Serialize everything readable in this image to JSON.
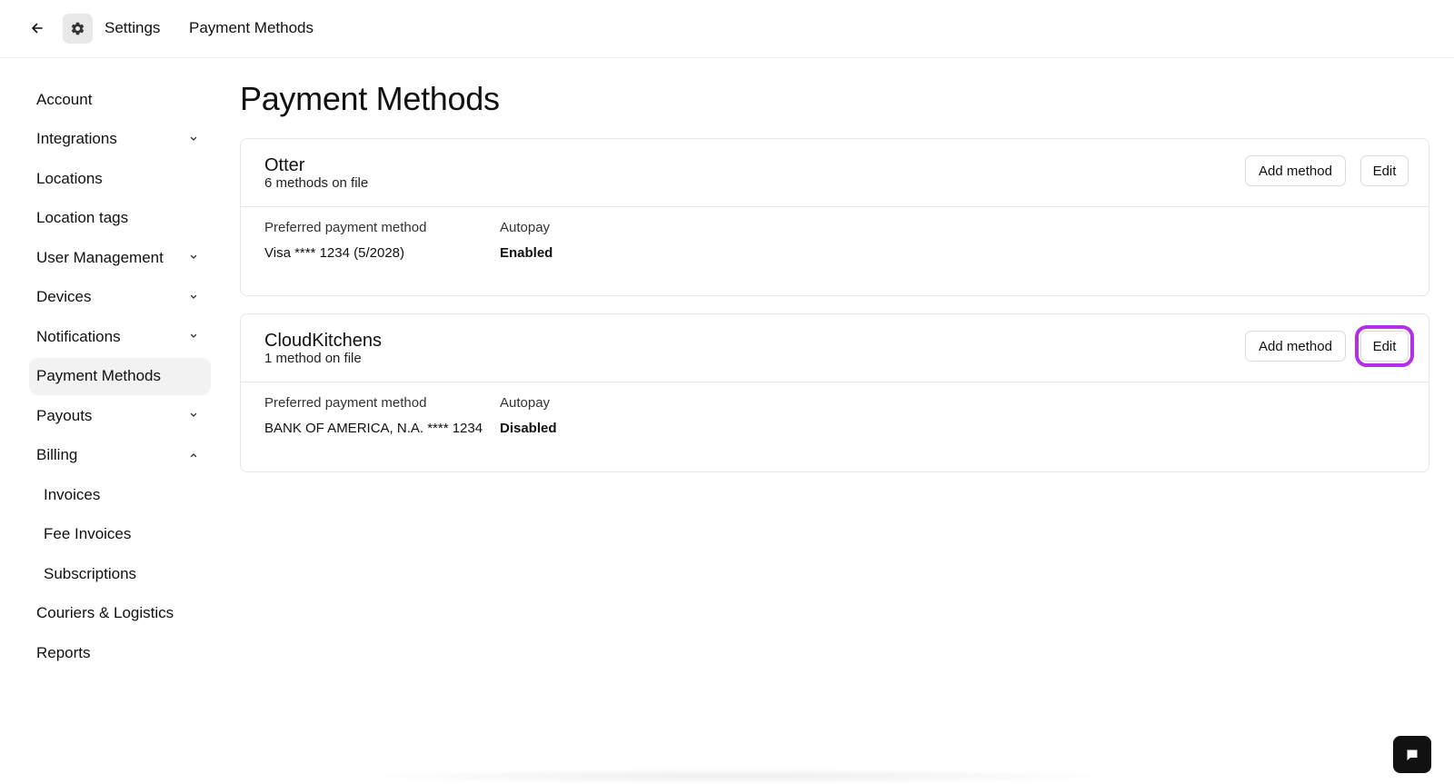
{
  "header": {
    "back_icon": "arrow-left-icon",
    "gear_icon": "gear-icon",
    "breadcrumb_settings": "Settings",
    "breadcrumb_current": "Payment Methods"
  },
  "sidebar": {
    "items": [
      {
        "label": "Account",
        "chevron": "none"
      },
      {
        "label": "Integrations",
        "chevron": "down"
      },
      {
        "label": "Locations",
        "chevron": "none"
      },
      {
        "label": "Location tags",
        "chevron": "none"
      },
      {
        "label": "User Management",
        "chevron": "down"
      },
      {
        "label": "Devices",
        "chevron": "down"
      },
      {
        "label": "Notifications",
        "chevron": "down"
      },
      {
        "label": "Payment Methods",
        "chevron": "none",
        "active": true
      },
      {
        "label": "Payouts",
        "chevron": "down"
      },
      {
        "label": "Billing",
        "chevron": "up"
      },
      {
        "label": "Invoices",
        "sub": true
      },
      {
        "label": "Fee Invoices",
        "sub": true
      },
      {
        "label": "Subscriptions",
        "sub": true
      },
      {
        "label": "Couriers & Logistics",
        "chevron": "none"
      },
      {
        "label": "Reports",
        "chevron": "none"
      }
    ]
  },
  "main": {
    "title": "Payment Methods",
    "cards": [
      {
        "name": "Otter",
        "count": "6 methods on file",
        "add_label": "Add method",
        "edit_label": "Edit",
        "preferred_label": "Preferred payment method",
        "preferred_value": "Visa **** 1234 (5/2028)",
        "autopay_label": "Autopay",
        "autopay_value": "Enabled"
      },
      {
        "name": "CloudKitchens",
        "count": "1 method on file",
        "add_label": "Add method",
        "edit_label": "Edit",
        "preferred_label": "Preferred payment method",
        "preferred_value": "BANK OF AMERICA, N.A. **** 1234",
        "autopay_label": "Autopay",
        "autopay_value": "Disabled"
      }
    ]
  },
  "chat": {
    "icon": "chat-bubble-icon"
  },
  "colors": {
    "highlight": "#b42ee6",
    "active_bg": "#f2f2f2",
    "border": "#e6e6e6"
  }
}
